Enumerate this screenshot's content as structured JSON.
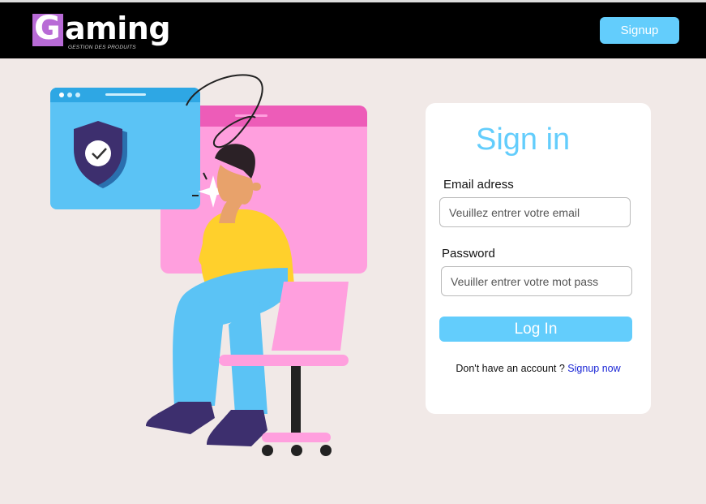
{
  "header": {
    "logo_letter": "G",
    "logo_text": "aming",
    "logo_subtitle": "GESTION DES PRODUITS",
    "signup_label": "Signup"
  },
  "login": {
    "title": "Sign in",
    "email_label": "Email adress",
    "email_placeholder": "Veuillez entrer votre email",
    "password_label": "Password",
    "password_placeholder": "Veuiller entrer votre mot pass",
    "login_button": "Log In",
    "no_account_text": "Don't have an account ?",
    "signup_link": "Signup now"
  },
  "colors": {
    "accent": "#63cdfc",
    "background": "#f1e9e7",
    "header_bg": "#000000",
    "logo_badge": "#b86bd6",
    "link": "#1b27d6"
  },
  "illustration": {
    "icons": [
      "shield-check-icon",
      "browser-window",
      "person-thinking",
      "desk-chair"
    ]
  }
}
